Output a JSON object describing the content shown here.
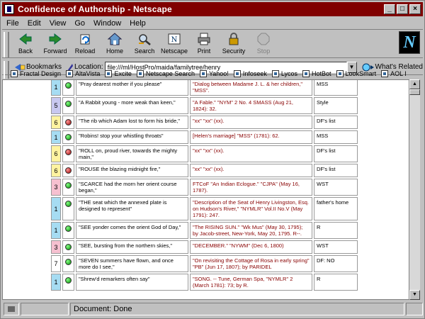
{
  "window": {
    "title": "Confidence of Authorship - Netscape"
  },
  "menu": [
    "File",
    "Edit",
    "View",
    "Go",
    "Window",
    "Help"
  ],
  "toolbar": {
    "back": "Back",
    "forward": "Forward",
    "reload": "Reload",
    "home": "Home",
    "search": "Search",
    "netscape": "Netscape",
    "print": "Print",
    "security": "Security",
    "stop": "Stop"
  },
  "location": {
    "bookmarks": "Bookmarks",
    "label": "Location:",
    "url": "file:///ml/HostPro/maida/familytree/henry",
    "whats_related": "What's Related"
  },
  "personal_toolbar": [
    "Fractal Design",
    "AltaVista",
    "Excite",
    "Netscape Search",
    "Yahoo!",
    "Infoseek",
    "Lycos",
    "HotBot",
    "LookSmart",
    "AOL I"
  ],
  "colors": {
    "one": "#a6dcf2",
    "five": "#c8c8f0",
    "six": "#fff3a0",
    "three": "#f6c0d0",
    "seven": "#ffffff"
  },
  "rows": [
    {
      "num": "1",
      "color": "one",
      "light": "green",
      "first": "\"Pray dearest mother if you please\"",
      "source": "\"Dialog between Madame J. L. & her children,\" \"MSS\".",
      "loc": "MSS"
    },
    {
      "num": "5",
      "color": "five",
      "light": "green",
      "first": "\"A Rabbit young - more weak than keen,\"",
      "source": "\"A Fable.\" \"NYM\" 2 No. 4 SMASS (Aug 21, 1824): 32.",
      "loc": "Style"
    },
    {
      "num": "6",
      "color": "six",
      "light": "red",
      "first": "\"The rib which Adam lost to form his bride,\"",
      "source": "\"xx\" \"xx\" (xx).",
      "loc": "DF's list"
    },
    {
      "num": "1",
      "color": "one",
      "light": "green",
      "first": "\"Robins! stop your whistling throats\"",
      "source": "[Helen's marriage] \"MSS\" (1781): 62.",
      "loc": "MSS"
    },
    {
      "num": "6",
      "color": "six",
      "light": "red",
      "first": "\"ROLL on, proud river, towards the mighty main,\"",
      "source": "\"xx\" \"xx\" (xx).",
      "loc": "DF's list"
    },
    {
      "num": "6",
      "color": "six",
      "light": "red",
      "first": "\"ROUSE the blazing midnight fire,\"",
      "source": "\"xx\" \"xx\" (xx).",
      "loc": "DF's list"
    },
    {
      "num": "3",
      "color": "three",
      "light": "green",
      "first": "\"SCARCE had the morn her orient course began,\"",
      "source": "FTCoF \"An Indian Eclogue.\" \"CJPA\" (May 16, 1787).",
      "loc": "WST"
    },
    {
      "num": "1",
      "color": "one",
      "light": "green",
      "first": "\"THE seat which the annexed plate is designed to represent\"",
      "source": "\"Description of the Seat of Henry Livingston, Esq. on Hudson's River,\" \"NYMLR\" Vol.II No.V (May 1791): 247.",
      "loc": "father's home"
    },
    {
      "num": "1",
      "color": "one",
      "light": "green",
      "first": "\"SEE yonder comes the orient God of Day,\"",
      "source": "\"The RISING SUN.\" \"Wk Mus\" (May 30, 1795); by Jacob-street, New-York, May 20, 1795. R--.",
      "loc": "R"
    },
    {
      "num": "3",
      "color": "three",
      "light": "green",
      "first": "\"SEE, bursting from the northern skies,\"",
      "source": "\"DECEMBER.\" \"NYWM\" (Dec 6, 1800)",
      "loc": "WST"
    },
    {
      "num": "7",
      "color": "seven",
      "light": "green",
      "first": "\"SEVEN summers have flown, and once more do I see,\"",
      "source": "\"On revisiting the Cottage of Rosa in early spring\" \"PB\" (Jun 17, 1807); by PARIDEL",
      "loc": "DF: NO"
    },
    {
      "num": "1",
      "color": "one",
      "light": "green",
      "first": "\"Shrew'd remarkers often say\"",
      "source": "\"SONG. -- Tune, German Spa, \"NYMLR\" 2 (March 1781): 73; by R.",
      "loc": "R"
    }
  ],
  "status": {
    "text": "Document: Done"
  }
}
